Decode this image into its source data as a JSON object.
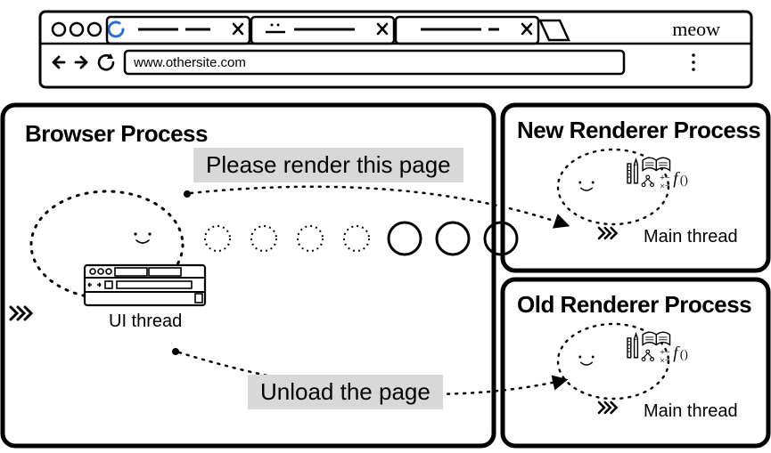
{
  "browser_window": {
    "brand": "meow",
    "url": "www.othersite.com"
  },
  "processes": {
    "browser": {
      "title": "Browser Process",
      "ui_thread_label": "UI thread"
    },
    "new_renderer": {
      "title": "New Renderer Process",
      "main_thread_label": "Main thread"
    },
    "old_renderer": {
      "title": "Old Renderer Process",
      "main_thread_label": "Main thread"
    }
  },
  "messages": {
    "render": "Please render this page",
    "unload": "Unload the page"
  }
}
